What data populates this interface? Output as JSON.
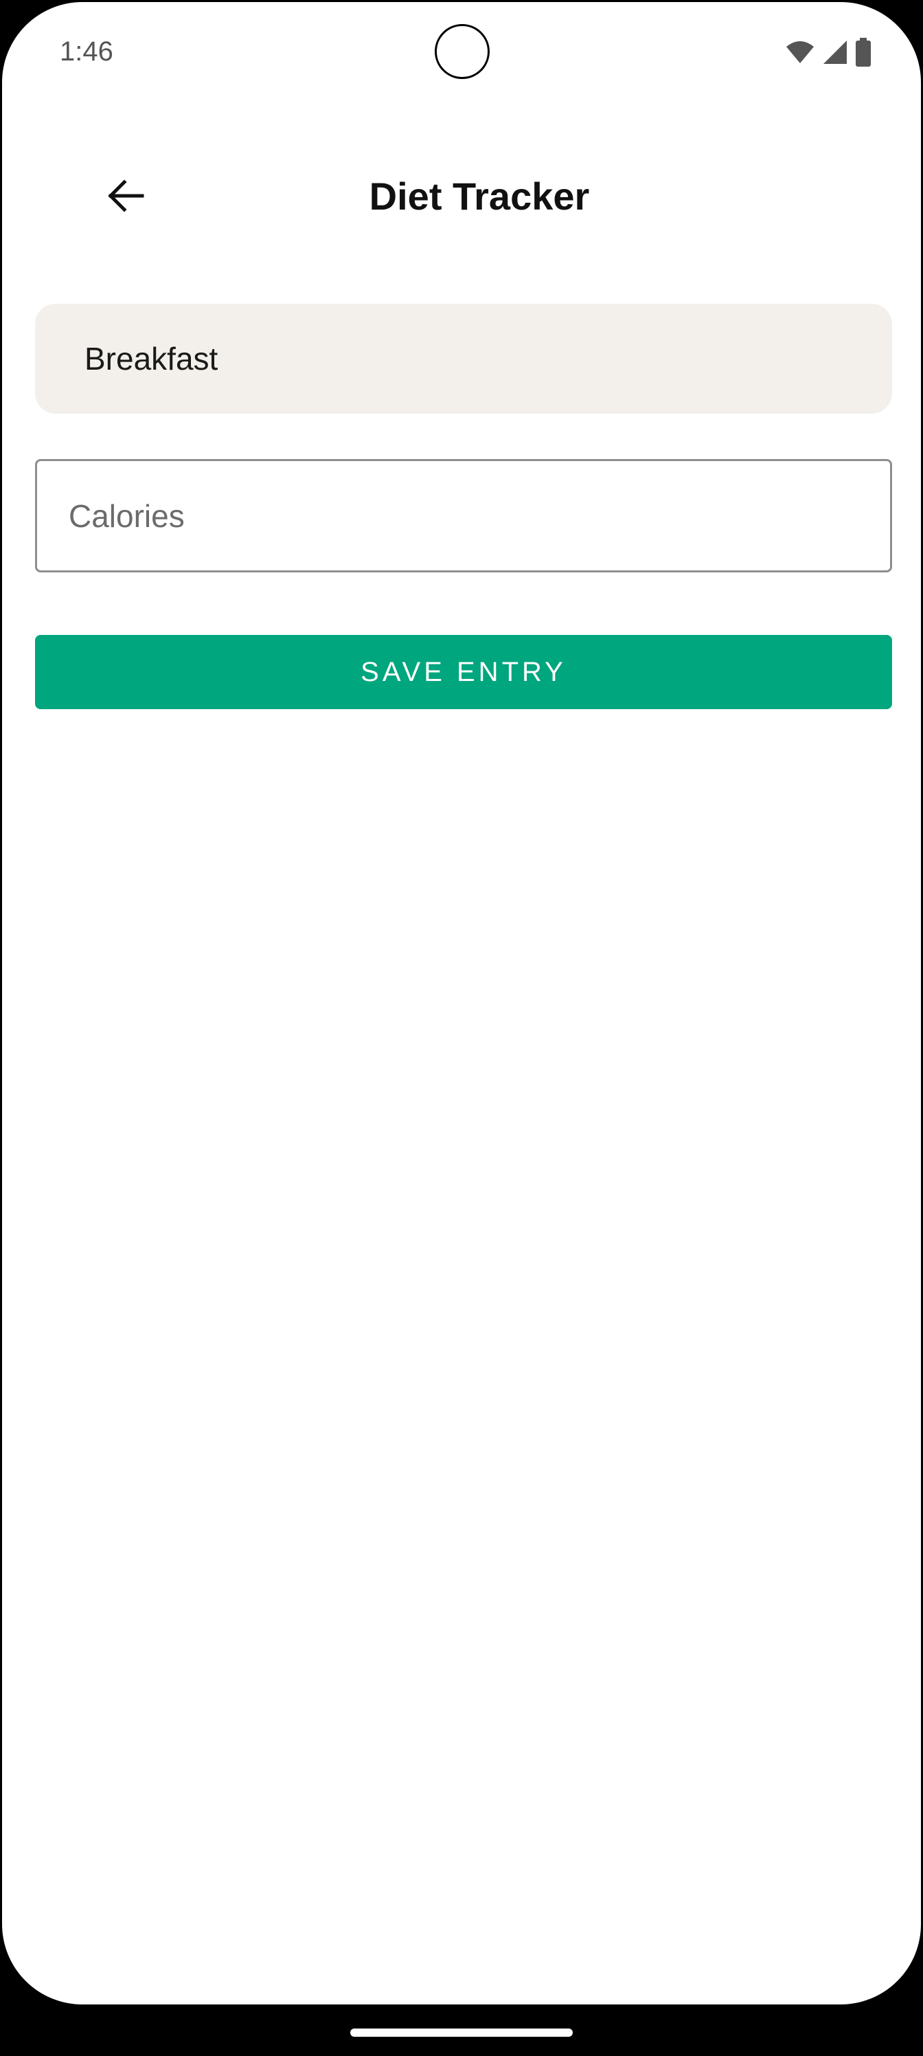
{
  "status_bar": {
    "time": "1:46",
    "icons": [
      "wifi-icon",
      "signal-icon",
      "battery-icon"
    ]
  },
  "app_bar": {
    "back_icon": "arrow-back-icon",
    "title": "Diet Tracker"
  },
  "form": {
    "meal_type": "Breakfast",
    "calories": {
      "value": "",
      "placeholder": "Calories"
    },
    "save_label": "SAVE ENTRY"
  },
  "colors": {
    "accent": "#00a67d",
    "filled_field_bg": "#f3efea",
    "outline": "#8e8e8e"
  }
}
